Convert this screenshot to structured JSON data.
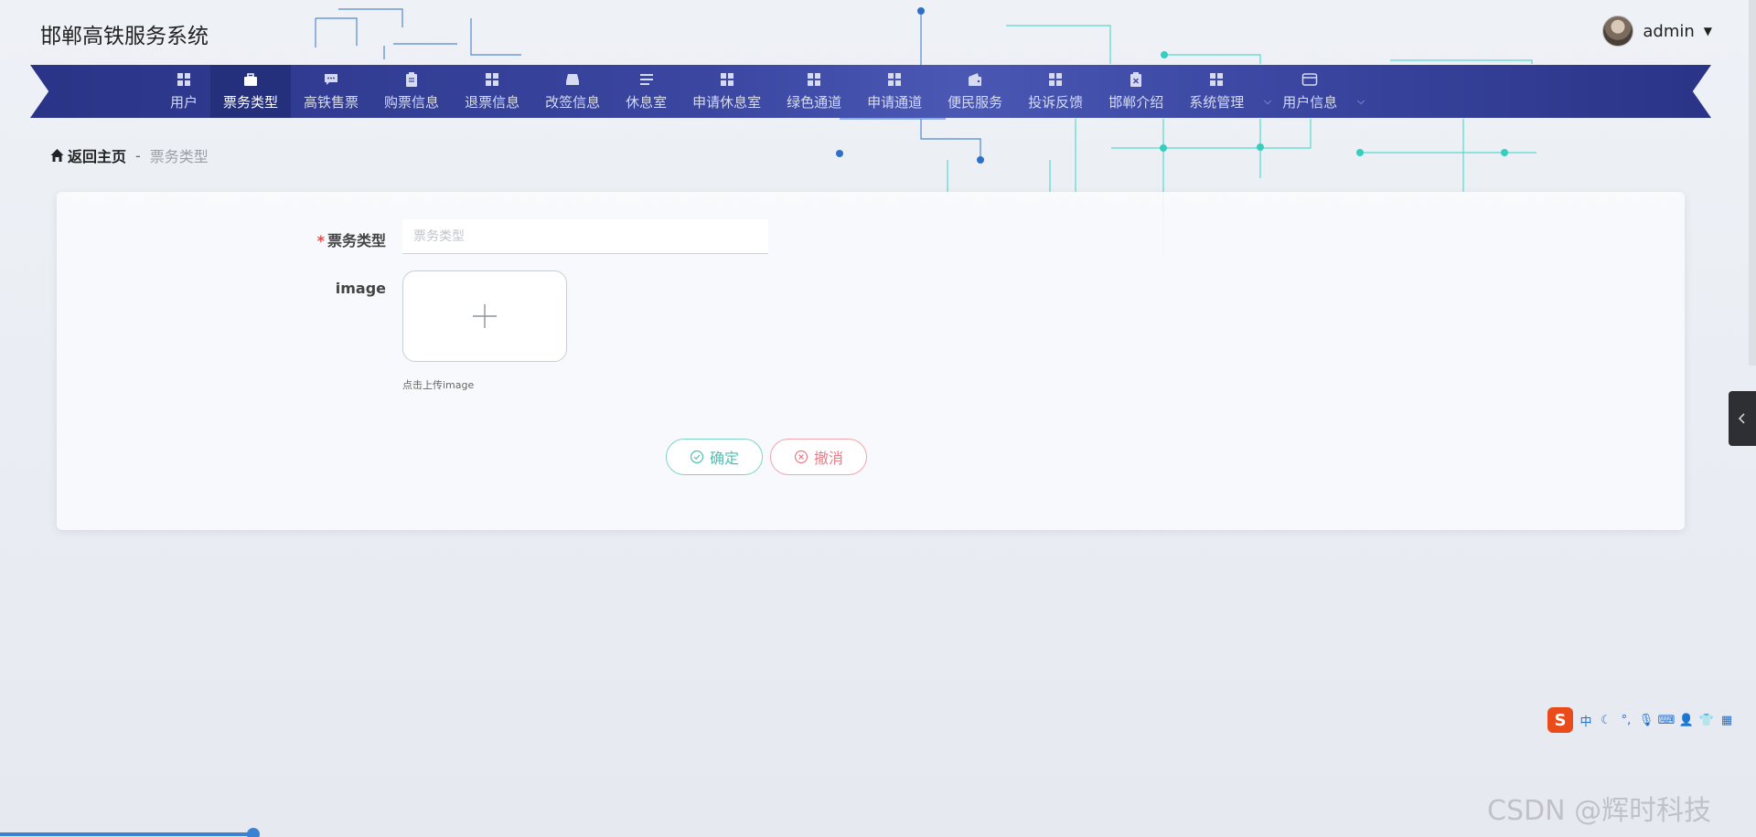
{
  "app": {
    "title": "邯郸高铁服务系统"
  },
  "user": {
    "name": "admin"
  },
  "nav": {
    "items": [
      {
        "label": "用户",
        "icon": "grid-icon",
        "active": false
      },
      {
        "label": "票务类型",
        "icon": "briefcase-icon",
        "active": true
      },
      {
        "label": "高铁售票",
        "icon": "chat-icon",
        "active": false
      },
      {
        "label": "购票信息",
        "icon": "clipboard-icon",
        "active": false
      },
      {
        "label": "退票信息",
        "icon": "grid-icon",
        "active": false
      },
      {
        "label": "改签信息",
        "icon": "inbox-icon",
        "active": false
      },
      {
        "label": "休息室",
        "icon": "list-icon",
        "active": false
      },
      {
        "label": "申请休息室",
        "icon": "grid-icon",
        "active": false
      },
      {
        "label": "绿色通道",
        "icon": "grid-icon",
        "active": false
      },
      {
        "label": "申请通道",
        "icon": "grid-icon",
        "active": false
      },
      {
        "label": "便民服务",
        "icon": "wallet-icon",
        "active": false
      },
      {
        "label": "投诉反馈",
        "icon": "grid-icon",
        "active": false
      },
      {
        "label": "邯郸介绍",
        "icon": "clipboard-x-icon",
        "active": false
      },
      {
        "label": "系统管理",
        "icon": "grid-icon",
        "active": false,
        "dropdown": true
      },
      {
        "label": "用户信息",
        "icon": "card-icon",
        "active": false,
        "dropdown": true
      }
    ]
  },
  "breadcrumb": {
    "home": "返回主页",
    "separator": "-",
    "current": "票务类型"
  },
  "form": {
    "ticket_type": {
      "label": "票务类型",
      "placeholder": "票务类型",
      "value": "",
      "required": "*"
    },
    "image": {
      "label": "image",
      "tip": "点击上传image"
    },
    "buttons": {
      "confirm": "确定",
      "cancel": "撤消"
    }
  },
  "ime": {
    "mode": "中"
  },
  "watermark": "CSDN @辉时科技",
  "colors": {
    "nav_bg": "#3a46a0",
    "nav_active": "#25307c",
    "confirm": "#52bfb1",
    "cancel": "#ec7b87",
    "required": "#e04b4b"
  }
}
